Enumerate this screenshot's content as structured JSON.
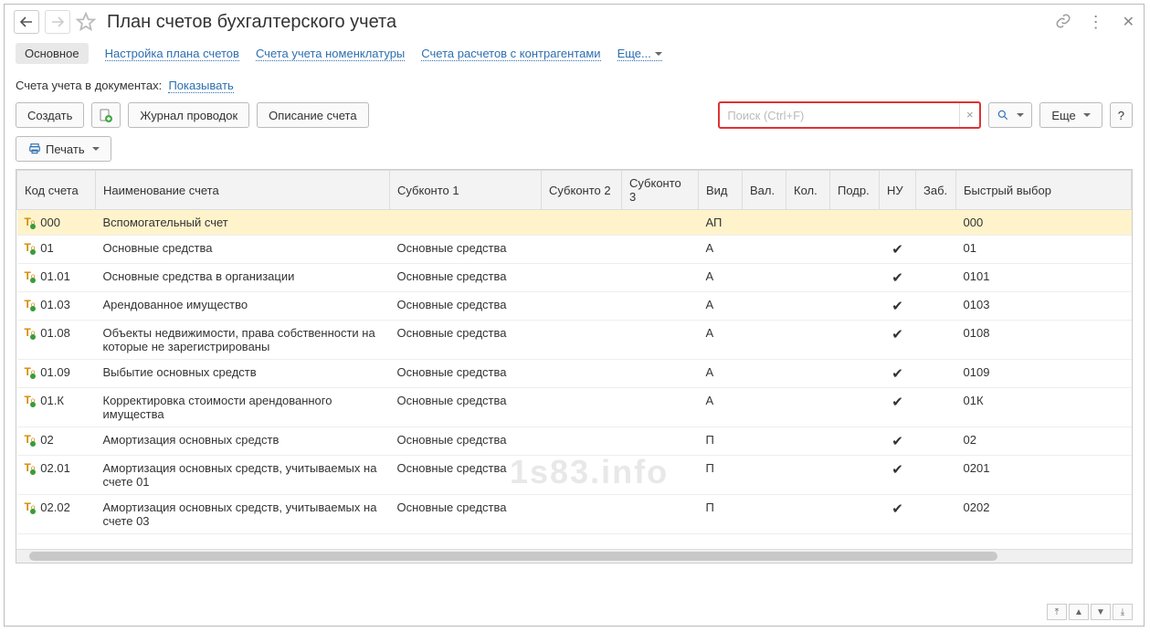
{
  "title": "План счетов бухгалтерского учета",
  "tabs": {
    "main": "Основное",
    "setup": "Настройка плана счетов",
    "nomen": "Счета учета номенклатуры",
    "contr": "Счета расчетов с контрагентами",
    "more": "Еще..."
  },
  "docline": {
    "label": "Счета учета в документах:",
    "link": "Показывать"
  },
  "toolbar": {
    "create": "Создать",
    "journal": "Журнал проводок",
    "desc": "Описание счета",
    "search_placeholder": "Поиск (Ctrl+F)",
    "more": "Еще",
    "help": "?",
    "print": "Печать"
  },
  "columns": {
    "code": "Код счета",
    "name": "Наименование счета",
    "s1": "Субконто 1",
    "s2": "Субконто 2",
    "s3": "Субконто 3",
    "vid": "Вид",
    "val": "Вал.",
    "kol": "Кол.",
    "podr": "Подр.",
    "nu": "НУ",
    "zab": "Заб.",
    "fast": "Быстрый выбор"
  },
  "rows": [
    {
      "code": "000",
      "name": "Вспомогательный счет",
      "s1": "",
      "vid": "АП",
      "nu": false,
      "fast": "000",
      "selected": true
    },
    {
      "code": "01",
      "name": "Основные средства",
      "s1": "Основные средства",
      "vid": "А",
      "nu": true,
      "fast": "01"
    },
    {
      "code": "01.01",
      "name": "Основные средства в организации",
      "s1": "Основные средства",
      "vid": "А",
      "nu": true,
      "fast": "0101"
    },
    {
      "code": "01.03",
      "name": "Арендованное имущество",
      "s1": "Основные средства",
      "vid": "А",
      "nu": true,
      "fast": "0103"
    },
    {
      "code": "01.08",
      "name": "Объекты недвижимости, права собственности на которые не зарегистрированы",
      "s1": "Основные средства",
      "vid": "А",
      "nu": true,
      "fast": "0108"
    },
    {
      "code": "01.09",
      "name": "Выбытие основных средств",
      "s1": "Основные средства",
      "vid": "А",
      "nu": true,
      "fast": "0109"
    },
    {
      "code": "01.К",
      "name": "Корректировка стоимости арендованного имущества",
      "s1": "Основные средства",
      "vid": "А",
      "nu": true,
      "fast": "01К"
    },
    {
      "code": "02",
      "name": "Амортизация основных средств",
      "s1": "Основные средства",
      "vid": "П",
      "nu": true,
      "fast": "02"
    },
    {
      "code": "02.01",
      "name": "Амортизация основных средств, учитываемых на счете 01",
      "s1": "Основные средства",
      "vid": "П",
      "nu": true,
      "fast": "0201"
    },
    {
      "code": "02.02",
      "name": "Амортизация основных средств, учитываемых на счете 03",
      "s1": "Основные средства",
      "vid": "П",
      "nu": true,
      "fast": "0202"
    }
  ],
  "watermark": "1s83.info"
}
